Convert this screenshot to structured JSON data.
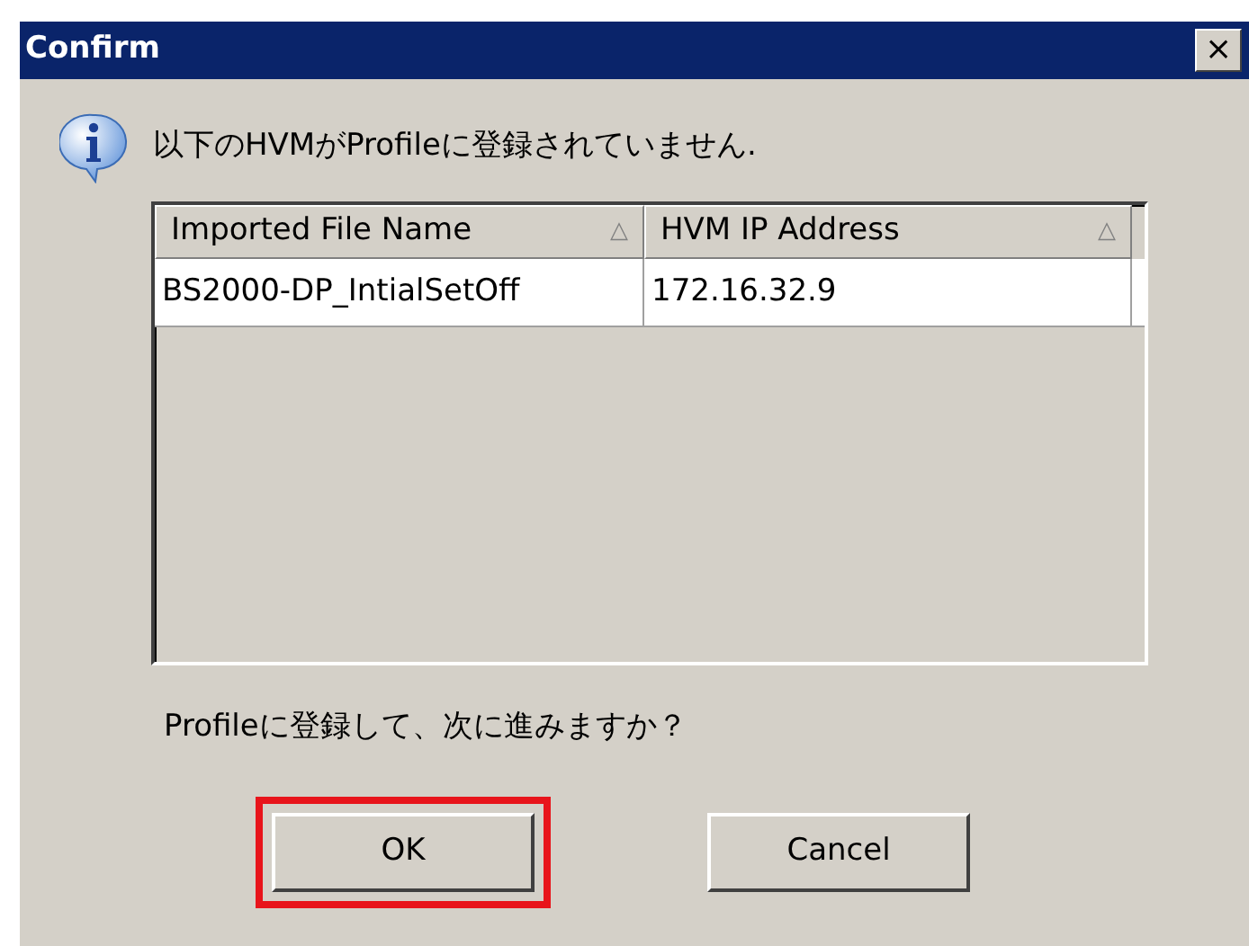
{
  "window": {
    "title": "Confirm",
    "close": "×"
  },
  "message": "以下のHVMがProfileに登録されていません.",
  "table": {
    "columns": [
      {
        "label": "Imported File Name",
        "sort_indicator": "△"
      },
      {
        "label": "HVM IP Address",
        "sort_indicator": "△"
      }
    ],
    "rows": [
      [
        "BS2000-DP_IntialSetOff",
        "172.16.32.9"
      ]
    ]
  },
  "question": "Profileに登録して、次に進みますか？",
  "buttons": [
    {
      "label": "OK",
      "highlighted": true
    },
    {
      "label": "Cancel",
      "highlighted": false
    }
  ]
}
